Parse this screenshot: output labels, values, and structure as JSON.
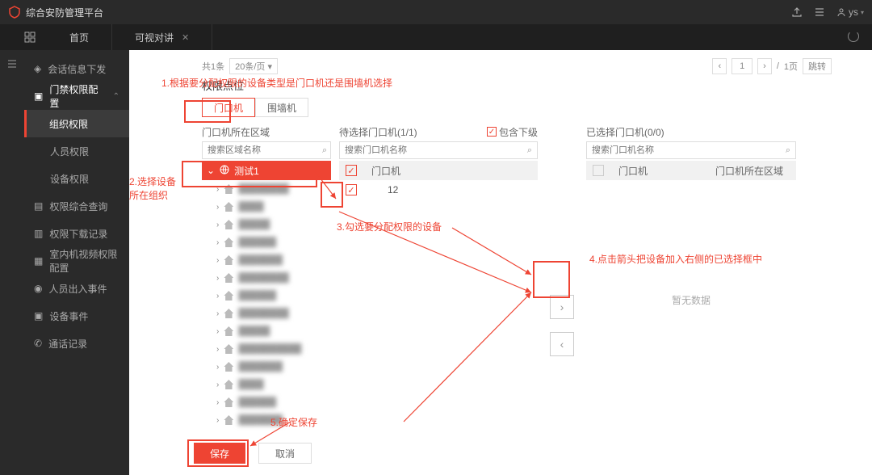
{
  "topbar": {
    "title": "综合安防管理平台",
    "user": "ys"
  },
  "tabs": [
    {
      "label": "首页",
      "closable": false
    },
    {
      "label": "可视对讲",
      "closable": true
    }
  ],
  "sidenav": {
    "items": [
      {
        "label": "会话信息下发",
        "icon": "session-icon"
      },
      {
        "label": "门禁权限配置",
        "icon": "access-icon",
        "expanded": true,
        "children": [
          {
            "label": "组织权限",
            "active": true
          },
          {
            "label": "人员权限"
          },
          {
            "label": "设备权限"
          }
        ]
      },
      {
        "label": "权限综合查询",
        "icon": "query-icon"
      },
      {
        "label": "权限下载记录",
        "icon": "download-icon"
      },
      {
        "label": "室内机视频权限配置",
        "icon": "video-icon"
      },
      {
        "label": "人员出入事件",
        "icon": "person-icon"
      },
      {
        "label": "设备事件",
        "icon": "device-icon"
      },
      {
        "label": "通话记录",
        "icon": "call-icon"
      }
    ]
  },
  "pager": {
    "total_prefix": "共1条",
    "per_page": "20条/页",
    "page_sep": "/",
    "total_pages": "1页",
    "jump": "跳转"
  },
  "annotations": {
    "a1": "1.根据要分配权限的设备类型是门口机还是围墙机选择",
    "a2_line1": "2.选择设备",
    "a2_line2": "所在组织",
    "a3": "3.勾选要分配权限的设备",
    "a4": "4.点击箭头把设备加入右侧的已选择框中",
    "a5": "5.确定保存"
  },
  "section": {
    "title": "权限点位"
  },
  "devtabs": [
    {
      "label": "门口机",
      "active": true
    },
    {
      "label": "围墙机"
    }
  ],
  "col1": {
    "head": "门口机所在区域",
    "search_placeholder": "搜索区域名称",
    "root": "测试1",
    "tree_items_count": 15,
    "more": "???"
  },
  "col2": {
    "head": "待选择门口机(1/1)",
    "include_sub": "包含下级",
    "search_placeholder": "搜索门口机名称",
    "header_chk": true,
    "header_name": "门口机",
    "row1_label": "12"
  },
  "col4": {
    "head": "已选择门口机(0/0)",
    "search_placeholder": "搜索门口机名称",
    "header_name": "门口机",
    "header_area": "门口机所在区域",
    "nodata": "暂无数据"
  },
  "buttons": {
    "save": "保存",
    "cancel": "取消"
  }
}
